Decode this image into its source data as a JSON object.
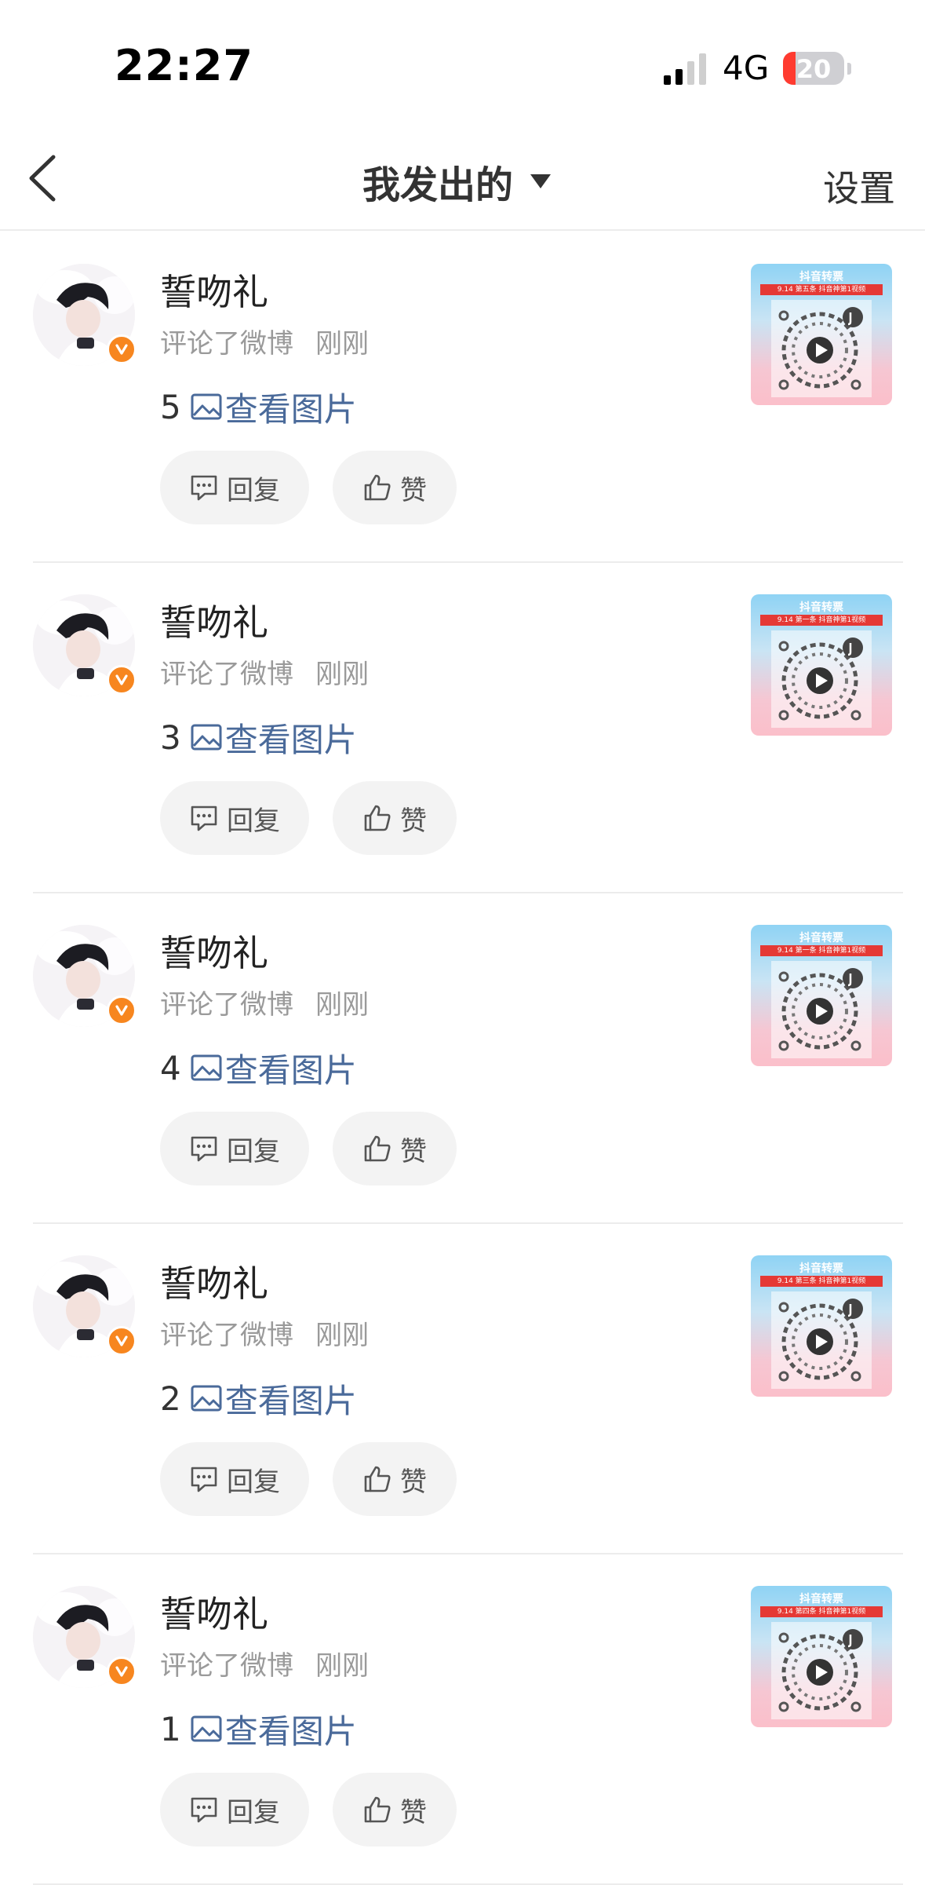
{
  "status_bar": {
    "time": "22:27",
    "network": "4G",
    "battery": "20",
    "battery_level": 0.2
  },
  "nav": {
    "title": "我发出的",
    "settings_label": "设置"
  },
  "actions": {
    "reply_label": "回复",
    "like_label": "赞"
  },
  "comments": [
    {
      "username": "誓吻礼",
      "action_text": "评论了微博",
      "time": "刚刚",
      "content_number": "5",
      "image_link": "查看图片",
      "thumb_header": "抖音转票",
      "thumb_banner": "9.14 第五条 抖音神第1视频"
    },
    {
      "username": "誓吻礼",
      "action_text": "评论了微博",
      "time": "刚刚",
      "content_number": "3",
      "image_link": "查看图片",
      "thumb_header": "抖音转票",
      "thumb_banner": "9.14 第一条 抖音神第1视频"
    },
    {
      "username": "誓吻礼",
      "action_text": "评论了微博",
      "time": "刚刚",
      "content_number": "4",
      "image_link": "查看图片",
      "thumb_header": "抖音转票",
      "thumb_banner": "9.14 第一条 抖音神第1视频"
    },
    {
      "username": "誓吻礼",
      "action_text": "评论了微博",
      "time": "刚刚",
      "content_number": "2",
      "image_link": "查看图片",
      "thumb_header": "抖音转票",
      "thumb_banner": "9.14 第三条 抖音神第1视频"
    },
    {
      "username": "誓吻礼",
      "action_text": "评论了微博",
      "time": "刚刚",
      "content_number": "1",
      "image_link": "查看图片",
      "thumb_header": "抖音转票",
      "thumb_banner": "9.14 第四条 抖音神第1视频"
    }
  ],
  "colors": {
    "link": "#4a6a9a",
    "verified_badge": "#f7861f",
    "battery_low": "#ff3b30",
    "button_bg": "#f3f3f3"
  },
  "icons": {
    "back": "chevron-left-icon",
    "dropdown": "caret-down-icon",
    "picture": "picture-icon",
    "reply": "comment-bubble-icon",
    "like": "thumbs-up-icon",
    "verified": "verified-v-icon",
    "play": "play-icon"
  }
}
